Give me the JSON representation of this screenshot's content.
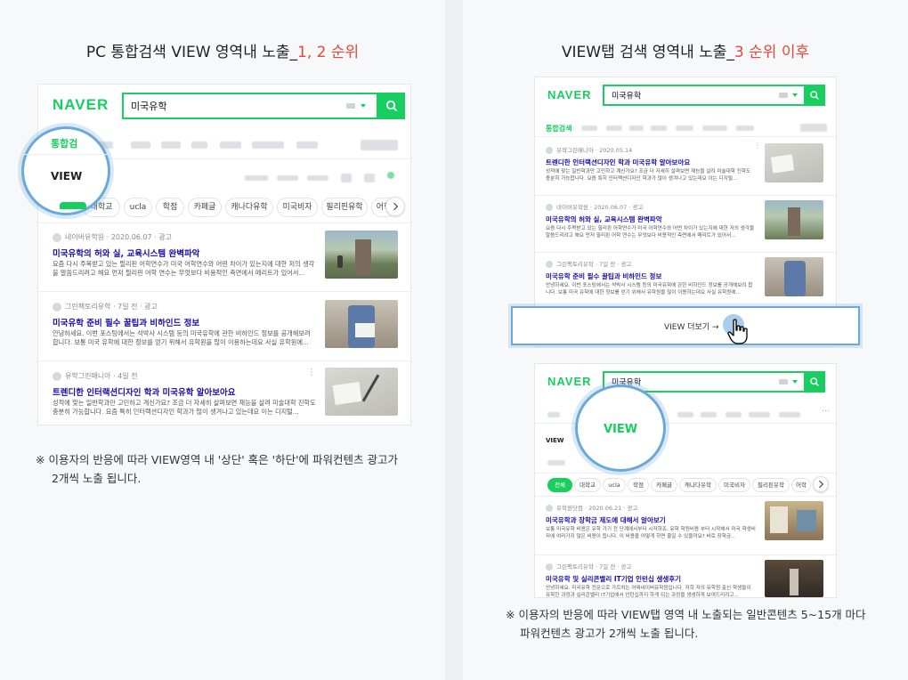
{
  "left_panel": {
    "title": {
      "main": "PC 통합검색 VIEW 영역내 노출_",
      "highlight": "1, 2 순위"
    },
    "naver": {
      "logo": "NAVER",
      "query": "미국유학"
    },
    "callout": {
      "tab_label": "통합검",
      "view_label": "VIEW"
    },
    "chips": [
      "대학교",
      "ucla",
      "학점",
      "카페글",
      "캐나다유학",
      "미국비자",
      "필리핀유학",
      "어학"
    ],
    "results": [
      {
        "source": "네이버유학원",
        "date": "2020.06.07",
        "ad": "광고",
        "title": "미국유학의 허와 실, 교육시스템 완벽파악",
        "desc": "요즘 다시 주목받고 있는 필리핀 어학연수가 미국 어학연수와 어떤 차이가 있는지에 대한 저의 생각을 말씀드리려고 해요 먼저 필리핀 어학 연수는 무엇보다 비용적인 측면에서 메리트가 있어서..."
      },
      {
        "source": "그린팩토리유학",
        "date": "7일 전",
        "ad": "광고",
        "title": "미국유학 준비 필수 꿀팁과 비하인드 정보",
        "desc": "안녕하세요. 이번 포스팅에서는 석박사 시스템 등의 미국유학에 관한 비하인드 정보를 공개해보려 합니다. 보통 미국 유학에 대한 정보를 얻기 위해서 유학원을 많이 이용하는데요 사실 유학원에..."
      },
      {
        "source": "유학그린매니아",
        "date": "4일 전",
        "ad": "",
        "title": "트렌디한 인터랙션디자인 학과 미국유학 알아보아요",
        "desc": "성적에 맞는 일반학과만 고민하고 계신가요? 조금 더 자세히 살펴보면 재능을 살려 미술대학 진학도 충분히 가능합니다. 요즘 특히 인터랙션디자인 학과가 많이 생겨나고 있는데요 이는 디지털..."
      }
    ],
    "note": [
      "※ 이용자의 반응에 따라 VIEW영역 내 '상단' 혹은 '하단'에  파워컨텐츠 광고가",
      "2개씩 노출 됩니다."
    ]
  },
  "right_panel": {
    "title": {
      "main": "VIEW탭 검색 영역내 노출_",
      "highlight": "3 순위 이후"
    },
    "top_card": {
      "logo": "NAVER",
      "query": "미국유학",
      "tab_label": "통합검색",
      "results": [
        {
          "source": "유학그린매니아",
          "date": "2020.05.14",
          "ad": "",
          "title": "트렌디한 인터랙션디자인 학과 미국유학 알아보아요",
          "desc": "성적에 맞는 일반학과만 고민하고 계신가요? 조금 더 자세히 살펴보면 재능을 살려 미술대학 진학도 충분히 가능합니다. 요즘 특히 인터랙션디자인 학과가 많이 생겨나고 있는데요 이는 디지털..."
        },
        {
          "source": "네이버유학원",
          "date": "2020.06.07",
          "ad": "광고",
          "title": "미국유학의 허와 실, 교육시스템 완벽파악",
          "desc": "요즘 다시 주목받고 있는 필리핀 어학연수가 미국 어학연수와 어떤 차이가 있는지에 대한 저의 생각을 말씀드리려고 해요 먼저 필리핀 어학 연수는 무엇보다 비용적인 측면에서 메리트가 있어서..."
        },
        {
          "source": "그린팩토리유학",
          "date": "7일 전",
          "ad": "광고",
          "title": "미국유학 준비 필수 꿀팁과 비하인드 정보",
          "desc": "안녕하세요. 이번 포스팅에서는 석박사 시스템 등의 미국유학에 관한 비하인드 정보를 공개해보려 합니다. 보통 미국 유학에 대한 정보를 얻기 위해서 유학원을 많이 이용하는데요 사실 유학원에..."
        }
      ],
      "view_more": "VIEW 더보기 →"
    },
    "bottom_card": {
      "logo": "NAVER",
      "query": "미국유학",
      "callout_label": "VIEW",
      "view_label": "VIEW",
      "chips": [
        "전체",
        "대학교",
        "ucla",
        "학점",
        "카페글",
        "캐나다유학",
        "미국비자",
        "필리핀유학",
        "어학"
      ],
      "results": [
        {
          "source": "유학원닷컴",
          "date": "2020.06.21",
          "ad": "광고",
          "title": "미국유학과 장학금 제도에 대해서 알아보기",
          "desc": "보통 미국유학 비용은 유학 가기 전 단계에서부터 시작하죠. 유학 학원비용 부터 시작해서 미국 학생비자에 여러가지 많은 비용이 듭니다. 이 비용을 어떻게 하면 줄일 수 있을까요? 바로 장학금..."
        },
        {
          "source": "그린팩토리유학",
          "date": "7일 전",
          "ad": "광고",
          "title": "미국유학 및 실리콘밸리 IT기업 인턴십 생생후기",
          "desc": "안녕하세요. 미국유학 전문으로 가르치는 어쩌네이버유학원입니다. 저희 저의 유학원 출신 학생들이 유학한 과정과 실리콘밸리 IT기업에서 인턴십까지 하게 되는 과정을 생생하게 보여드리려고..."
        }
      ]
    },
    "note": [
      "※ 이용자의 반응에 따라 VIEW탭 영역 내 노출되는 일반콘텐츠 5~15개 마다",
      "파워컨텐츠 광고가 2개씩 노출 됩니다."
    ]
  }
}
